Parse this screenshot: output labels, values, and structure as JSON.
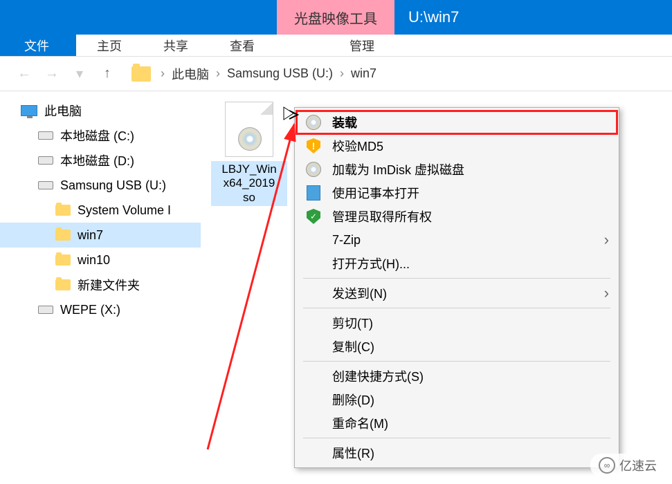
{
  "titlebar": {
    "tool_tab": "光盘映像工具",
    "title": "U:\\win7"
  },
  "ribbon": {
    "file": "文件",
    "home": "主页",
    "share": "共享",
    "view": "查看",
    "manage": "管理"
  },
  "breadcrumb": {
    "pc": "此电脑",
    "drive": "Samsung USB (U:)",
    "folder": "win7"
  },
  "tree": {
    "pc": "此电脑",
    "c": "本地磁盘 (C:)",
    "d": "本地磁盘 (D:)",
    "u": "Samsung USB (U:)",
    "svi": "System Volume I",
    "win7": "win7",
    "win10": "win10",
    "newf": "新建文件夹",
    "wepe": "WEPE (X:)"
  },
  "file": {
    "name": "LBJY_Win\nx64_2019\nso"
  },
  "ctx": {
    "mount": "装载",
    "md5": "校验MD5",
    "imdisk": "加载为 ImDisk 虚拟磁盘",
    "notepad": "使用记事本打开",
    "admin": "管理员取得所有权",
    "sevenzip": "7-Zip",
    "openwith": "打开方式(H)...",
    "sendto": "发送到(N)",
    "cut": "剪切(T)",
    "copy": "复制(C)",
    "shortcut": "创建快捷方式(S)",
    "delete": "删除(D)",
    "rename": "重命名(M)",
    "props": "属性(R)"
  },
  "watermark": "亿速云"
}
